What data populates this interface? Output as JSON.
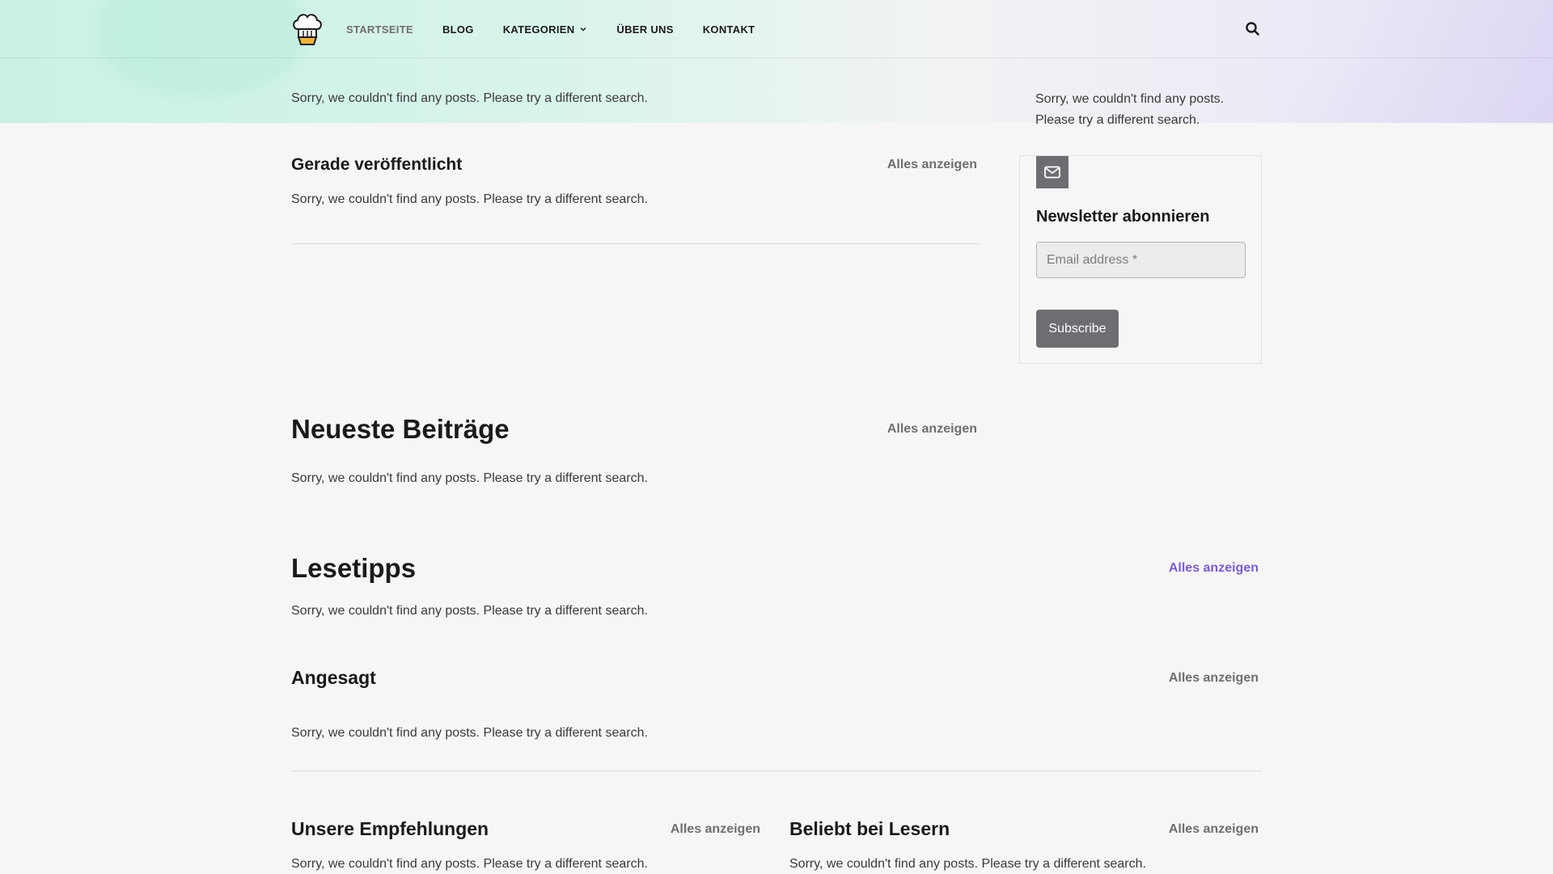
{
  "header": {
    "logo_icon": "chef-hat-logo-icon",
    "nav": [
      {
        "label": "STARTSEITE",
        "active": true
      },
      {
        "label": "BLOG"
      },
      {
        "label": "KATEGORIEN",
        "icon": "chevron-down-icon"
      },
      {
        "label": "ÜBER UNS"
      },
      {
        "label": "KONTAKT"
      }
    ],
    "search_icon": "search-icon"
  },
  "empty_message": "Sorry, we couldn't find any posts. Please try a different search.",
  "main": {
    "top_empty": "Sorry, we couldn't find any posts. Please try a different search.",
    "recent": {
      "title": "Gerade veröffentlicht",
      "view_all": "Alles anzeigen",
      "empty": "Sorry, we couldn't find any posts. Please try a different search."
    },
    "latest": {
      "title": "Neueste Beiträge",
      "view_all": "Alles anzeigen",
      "empty": "Sorry, we couldn't find any posts. Please try a different search."
    },
    "reading_tips": {
      "title": "Lesetipps",
      "view_all": "Alles anzeigen",
      "empty": "Sorry, we couldn't find any posts. Please try a different search."
    },
    "trending": {
      "title": "Angesagt",
      "view_all": "Alles anzeigen",
      "empty": "Sorry, we couldn't find any posts. Please try a different search."
    },
    "recommendations": {
      "title": "Unsere Empfehlungen",
      "view_all": "Alles anzeigen",
      "empty": "Sorry, we couldn't find any posts. Please try a different search."
    },
    "popular": {
      "title": "Beliebt bei Lesern",
      "view_all": "Alles anzeigen",
      "empty": "Sorry, we couldn't find any posts. Please try a different search."
    }
  },
  "sidebar": {
    "empty": "Sorry, we couldn't find any posts. Please try a different search.",
    "newsletter": {
      "icon": "envelope-icon",
      "title": "Newsletter abonnieren",
      "email_placeholder": "Email address *",
      "email_value": "",
      "subscribe_label": "Subscribe"
    }
  },
  "colors": {
    "accent_purple": "#7b5cd6",
    "button_gray": "#6d6d72",
    "hero_mint": "#c9f1e4",
    "hero_lavender": "#e2dcf4"
  }
}
